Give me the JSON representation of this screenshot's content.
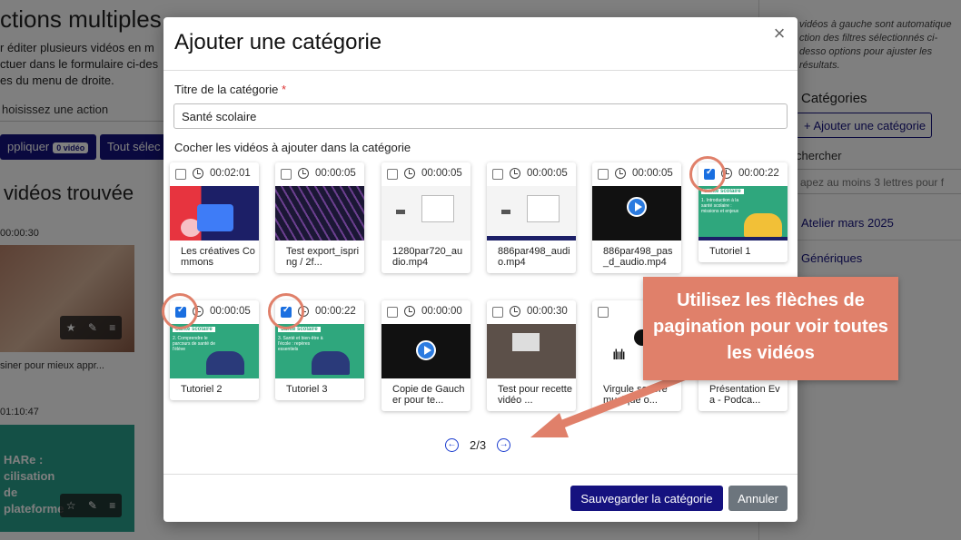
{
  "background": {
    "page_title": "ctions multiples",
    "description": "r éditer plusieurs vidéos en m ctuer dans le formulaire ci-des es du menu de droite.",
    "action_placeholder": "hoisissez une action",
    "apply_label": "ppliquer",
    "apply_count": "0 vidéo",
    "select_all_label": "Tout sélec",
    "found_label": "vidéos trouvée",
    "card1_duration": "00:00:30",
    "card1_title": "siner pour mieux appr...",
    "card2_duration": "01:10:47",
    "card2_brand": "HARe : cilisation de plateforme",
    "right": {
      "info": "vidéos à gauche sont automatique ction des filtres sélectionnés ci-desso options pour ajuster les résultats.",
      "categories_heading": "Catégories",
      "add_category": "+ Ajouter une catégorie",
      "search_label": "chercher",
      "search_placeholder": "apez au moins 3 lettres pour f",
      "items": [
        "Atelier mars 2025",
        "Génériques"
      ]
    }
  },
  "modal": {
    "title": "Ajouter une catégorie",
    "title_field_label": "Titre de la catégorie",
    "required_mark": "*",
    "title_value": "Santé scolaire",
    "check_label": "Cocher les vidéos à ajouter dans la catégorie",
    "videos": [
      {
        "duration": "00:02:01",
        "name": "Les créatives Commons",
        "checked": false
      },
      {
        "duration": "00:00:05",
        "name": "Test export_ispring / 2f...",
        "checked": false
      },
      {
        "duration": "00:00:05",
        "name": "1280par720_audio.mp4",
        "checked": false
      },
      {
        "duration": "00:00:05",
        "name": "886par498_audio.mp4",
        "checked": false
      },
      {
        "duration": "00:00:05",
        "name": "886par498_pas_d_audio.mp4",
        "checked": false
      },
      {
        "duration": "00:00:22",
        "name": "Tutoriel 1",
        "checked": true
      },
      {
        "duration": "00:00:05",
        "name": "Tutoriel 2",
        "checked": true
      },
      {
        "duration": "00:00:22",
        "name": "Tutoriel 3",
        "checked": true
      },
      {
        "duration": "00:00:00",
        "name": "Copie de Gaucher pour te...",
        "checked": false
      },
      {
        "duration": "00:00:30",
        "name": "Test pour recette vidéo ...",
        "checked": false
      },
      {
        "duration": "",
        "name": "Virgule sonore musique o...",
        "checked": false
      },
      {
        "duration": "",
        "name": "Présentation Eva - Podca...",
        "checked": false
      }
    ],
    "green_tag": "Santé scolaire",
    "green_texts": [
      "1. Introduction à la santé scolaire : missions et enjeux",
      "2. Comprendre le parcours de santé de l'élève",
      "3. Santé et bien-être à l'école : repères essentiels"
    ],
    "pagination": "2/3",
    "save_label": "Sauvegarder la catégorie",
    "cancel_label": "Annuler"
  },
  "annotation": {
    "callout": "Utilisez les flèches de pagination pour voir toutes les vidéos",
    "color": "#e0806a"
  },
  "colors": {
    "primary": "#15127f",
    "checkbox": "#1a6fe0"
  }
}
